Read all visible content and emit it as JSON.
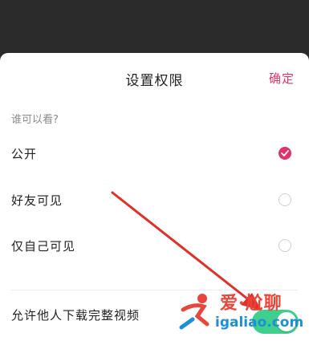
{
  "header": {
    "title": "设置权限",
    "confirm_label": "确定"
  },
  "visibility": {
    "section_label": "谁可以看?",
    "options": [
      {
        "label": "公开",
        "selected": true
      },
      {
        "label": "好友可见",
        "selected": false
      },
      {
        "label": "仅自己可见",
        "selected": false
      }
    ]
  },
  "download": {
    "label": "允许他人下载完整视频",
    "enabled": true
  },
  "watermark": {
    "line1": "爱·尬聊",
    "line2": "igaliao.com"
  },
  "colors": {
    "accent": "#e0336a",
    "toggle_on": "#3fcf8e",
    "arrow": "#e0302a"
  }
}
